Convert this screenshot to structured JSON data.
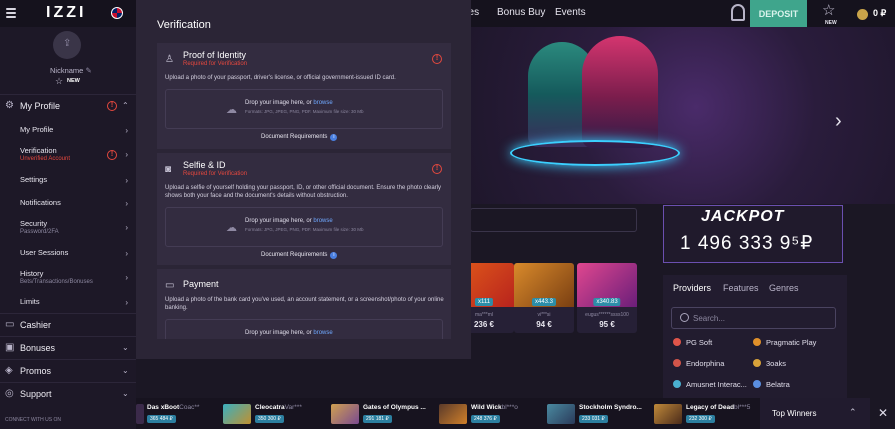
{
  "header": {
    "logo": "IZZI",
    "nav": [
      "Games",
      "Bonus Buy",
      "Events"
    ],
    "deposit_label": "DEPOSIT",
    "new_label": "NEW",
    "balance": "0 ₽"
  },
  "hero": {
    "jackpot_label": "JACKPOT",
    "jackpot_amount": "1 496 333 9⁵₽"
  },
  "games": [
    {
      "badge": "x111",
      "user": "ma***ml",
      "amount": "236 €"
    },
    {
      "badge": "x443.3",
      "user": "vi***si",
      "amount": "94 €"
    },
    {
      "badge": "x340.83",
      "user": "eugus******ssss100",
      "amount": "95 €"
    }
  ],
  "providers_panel": {
    "tabs": [
      "Providers",
      "Features",
      "Genres"
    ],
    "search_placeholder": "Search...",
    "items": [
      "PG Soft",
      "Pragmatic Play",
      "Endorphina",
      "3oaks",
      "Amusnet Interac...",
      "Belatra"
    ]
  },
  "winners": [
    {
      "game": "Das xBoot",
      "user": "Coac**",
      "amount": "365 484 ₽"
    },
    {
      "game": "Cleocatra",
      "user": "Var***",
      "amount": "350 300 ₽"
    },
    {
      "game": "Gates of Olympus ...",
      "user": "",
      "amount": "291 181 ₽"
    },
    {
      "game": "Wild Wick",
      "user": "bl***o",
      "amount": "248 376 ₽"
    },
    {
      "game": "Stockholm Syndro...",
      "user": "",
      "amount": "233 031 ₽"
    },
    {
      "game": "Legacy of Dead",
      "user": "bl***5",
      "amount": "232 300 ₽"
    }
  ],
  "top_winners_label": "Top Winners",
  "sidebar": {
    "nickname": "Nickname",
    "level_label": "NEW",
    "my_profile": "My Profile",
    "sub_items": [
      {
        "label": "My Profile",
        "sub": ""
      },
      {
        "label": "Verification",
        "sub": "Unverified Account"
      },
      {
        "label": "Settings",
        "sub": ""
      },
      {
        "label": "Notifications",
        "sub": ""
      },
      {
        "label": "Security",
        "sub": "Password/2FA"
      },
      {
        "label": "User Sessions",
        "sub": ""
      },
      {
        "label": "History",
        "sub": "Bets/Transactions/Bonuses"
      },
      {
        "label": "Limits",
        "sub": ""
      }
    ],
    "sections": [
      "Cashier",
      "Bonuses",
      "Promos",
      "Support"
    ],
    "connect_label": "CONNECT WITH US ON"
  },
  "verification": {
    "title": "Verification",
    "cards": [
      {
        "title": "Proof of Identity",
        "status": "Required for Verification",
        "description": "Upload a photo of your passport, driver's license, or official government-issued ID card.",
        "drop_text": "Drop your image here, or ",
        "browse": "browse",
        "formats": "Formats: JPG, JPEG, PNG, PDF. Maximum file size: 30 Mb",
        "doc_req": "Document Requirements"
      },
      {
        "title": "Selfie & ID",
        "status": "Required for Verification",
        "description": "Upload a selfie of yourself holding your passport, ID, or other official document. Ensure the photo clearly shows both your face and the document's details without obstruction.",
        "drop_text": "Drop your image here, or ",
        "browse": "browse",
        "formats": "Formats: JPG, JPEG, PNG, PDF. Maximum file size: 30 Mb",
        "doc_req": "Document Requirements"
      },
      {
        "title": "Payment",
        "status": "",
        "description": "Upload a photo of the bank card you've used, an account statement, or a screenshot/photo of your online banking.",
        "drop_text": "Drop your image here, or ",
        "browse": "browse"
      }
    ]
  },
  "colors": {
    "accent_green": "#3fa58c",
    "alert_red": "#e4483e",
    "link_blue": "#6fa8ff"
  }
}
